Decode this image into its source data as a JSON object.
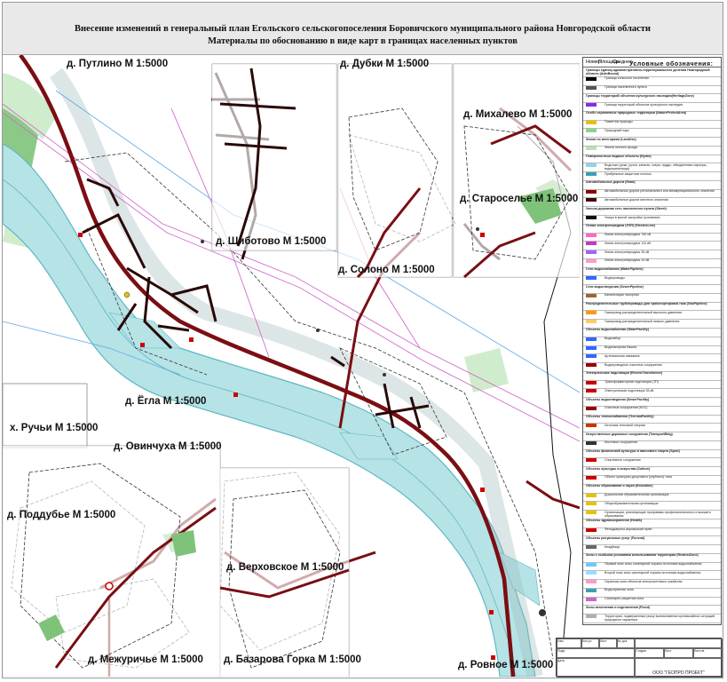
{
  "header": {
    "title_line1": "Внесение изменений в генеральный план Егольского сельскогопоселения Боровичского муниципального района Новгородской области",
    "title_line2": "Материалы по обоснованию в виде карт в границах населенных пунктов"
  },
  "map": {
    "labels": [
      {
        "id": "putilino",
        "text": "д. Путлино М 1:5000"
      },
      {
        "id": "dubki",
        "text": "д. Дубки М 1:5000"
      },
      {
        "id": "mikhalevo",
        "text": "д. Михалево М 1:5000"
      },
      {
        "id": "staroselye",
        "text": "д. Староселье М 1:5000"
      },
      {
        "id": "shibotovo",
        "text": "д. Шиботово М 1:5000"
      },
      {
        "id": "solono",
        "text": "д. Солоно М 1:5000"
      },
      {
        "id": "egla",
        "text": "д. Ёгла М 1:5000"
      },
      {
        "id": "ruchyi",
        "text": "х. Ручьи М 1:5000"
      },
      {
        "id": "ovinchukha",
        "text": "д. Овинчуха М 1:5000"
      },
      {
        "id": "poddubye",
        "text": "д. Поддубье М 1:5000"
      },
      {
        "id": "verkhovskoe",
        "text": "д. Верховское М 1:5000"
      },
      {
        "id": "mezhurichye",
        "text": "д. Межуричье М 1:5000"
      },
      {
        "id": "bazarova",
        "text": "д. Базарова Горка М 1:5000"
      },
      {
        "id": "rovnoe",
        "text": "д. Ровное М 1:5000"
      }
    ]
  },
  "legend": {
    "col1": "Номер",
    "col2": "Площадь",
    "col3": "Среднее",
    "title": "Условные обозначения:",
    "rows": [
      {
        "text": "Границы единиц административно-территориального деления Новгородской области (AdmBound)",
        "section": true
      },
      {
        "text": "Граница сельского поселения",
        "color": "#000000"
      },
      {
        "text": "Граница населенного пункта",
        "color": "#555555"
      },
      {
        "text": "Границы территорий объектов культурного наследия(HeritageZone)",
        "section": true
      },
      {
        "text": "Граница территорий объектов культурного наследия",
        "color": "#8a2be2"
      },
      {
        "text": "Особо охраняемые природные территории (NatureProtectArea)",
        "section": true
      },
      {
        "text": "Памятник природы",
        "color": "#e6c200"
      },
      {
        "text": "Природный парк",
        "color": "#8fd18f"
      },
      {
        "text": "Земли по категориям (LandUse)",
        "section": true
      },
      {
        "text": "Земли лесного фонда",
        "color": "#b7e3b0"
      },
      {
        "text": "Поверхностные водные объекты (Hydro)",
        "section": true
      },
      {
        "text": "Водотоки (реки, ручьи, каналы, озера, пруды, обводненные карьеры, водохранилища)",
        "color": "#8fd4e6"
      },
      {
        "text": "Прибрежные защитные полосы",
        "color": "#3aa0b5"
      },
      {
        "text": "Автомобильные дороги (Road)",
        "section": true
      },
      {
        "text": "Автомобильные дороги регионального или межмуниципального значения",
        "color": "#8b0000"
      },
      {
        "text": "Автомобильные дороги местного значения",
        "color": "#3a0a0a"
      },
      {
        "text": "Улично-дорожная сеть населенного пункта (Street)",
        "section": true
      },
      {
        "text": "Улицы в жилой застройке (основные)",
        "color": "#111111"
      },
      {
        "text": "Линии электропередачи (ЛЭП) (ElectricLine)",
        "section": true
      },
      {
        "text": "Линии электропередачи 750 кВ",
        "color": "#ff66cc"
      },
      {
        "text": "Линии электропередачи 110 кВ",
        "color": "#cc33cc"
      },
      {
        "text": "Линии электропередачи 35 кВ",
        "color": "#9966ff"
      },
      {
        "text": "Линии электропередачи 10 кВ",
        "color": "#ff99cc"
      },
      {
        "text": "Сети водоснабжения (WaterPipeline)",
        "section": true
      },
      {
        "text": "Водопроводы",
        "color": "#3366ff"
      },
      {
        "text": "Сети водоотведения (SewerPipeline)",
        "section": true
      },
      {
        "text": "Канализация напорная",
        "color": "#996633"
      },
      {
        "text": "Распределительные трубопроводы для транспортировки газа (GasPipeline)",
        "section": true
      },
      {
        "text": "Газопровод распределительный высокого давления",
        "color": "#ff9900"
      },
      {
        "text": "Газопровод распределительный низкого давления",
        "color": "#ffcc66"
      },
      {
        "text": "Объекты водоснабжения (WaterFacility)",
        "section": true
      },
      {
        "text": "Водозабор",
        "color": "#3366ff"
      },
      {
        "text": "Водонапорная башня",
        "color": "#3366ff"
      },
      {
        "text": "Артезианская скважина",
        "color": "#3366ff"
      },
      {
        "text": "Водопроводные очистные сооружения",
        "color": "#990000"
      },
      {
        "text": "Электрические подстанции (ElectricTransformer)",
        "section": true
      },
      {
        "text": "Трансформаторная подстанция (ТП)",
        "color": "#cc0000"
      },
      {
        "text": "Электрическая подстанция 35 кВ",
        "color": "#cc0000"
      },
      {
        "text": "Объекты водоотведения (SewerFacility)",
        "section": true
      },
      {
        "text": "Очистные сооружения (КОС)",
        "color": "#990000"
      },
      {
        "text": "Объекты теплоснабжения (ThermalFacility)",
        "section": true
      },
      {
        "text": "Источник тепловой энергии",
        "color": "#cc3300"
      },
      {
        "text": "Искусственные дорожные сооружения (TransportBldg)",
        "section": true
      },
      {
        "text": "Мостовое сооружение",
        "color": "#333333"
      },
      {
        "text": "Объекты физической культуры и массового спорта (Sport)",
        "section": true
      },
      {
        "text": "Спортивное сооружение",
        "color": "#cc0000"
      },
      {
        "text": "Объекты культуры и искусства (Culture)",
        "section": true
      },
      {
        "text": "Объект культурно-досугового (клубного) типа",
        "color": "#cc0000"
      },
      {
        "text": "Объекты образования и науки (Education)",
        "section": true
      },
      {
        "text": "Дошкольная образовательная организация",
        "color": "#e6c200"
      },
      {
        "text": "Общеобразовательная организация",
        "color": "#e6c200"
      },
      {
        "text": "Организации, реализующие программы профессионального и высшего образования",
        "color": "#e6c200"
      },
      {
        "text": "Объекты здравоохранения (Health)",
        "section": true
      },
      {
        "text": "Фельдшерско-акушерский пункт",
        "color": "#cc0000"
      },
      {
        "text": "Объекты ритуальных услуг (Funeral)",
        "section": true
      },
      {
        "text": "Кладбище",
        "color": "#666666"
      },
      {
        "text": "Зоны с особыми условиями использования территории (RestrictZone)",
        "section": true
      },
      {
        "text": "Первый пояс зоны санитарной охраны источника водоснабжения",
        "color": "#66ccff"
      },
      {
        "text": "Второй пояс зоны санитарной охраны источника водоснабжения",
        "color": "#99ddff"
      },
      {
        "text": "Охранная зона объектов электросетевого хозяйства",
        "color": "#ff99cc"
      },
      {
        "text": "Водоохранная зона",
        "color": "#3aa0b5"
      },
      {
        "text": "Санитарно-защитная зона",
        "color": "#cc66cc"
      },
      {
        "text": "Зоны затопления и подтопления (Flood)",
        "section": true
      },
      {
        "text": "Территории, подверженные риску возникновения чрезвычайных ситуаций природного характера",
        "color": "#b0b0b0"
      }
    ]
  },
  "stamp": {
    "org": "ООО \"ГЕОПРО ПРОЕКТ\"",
    "cells": [
      "Изм.",
      "Кол.уч",
      "Лист",
      "№ док",
      "Подп.",
      "Дата",
      "Стадия",
      "Лист",
      "Листов"
    ]
  },
  "colors": {
    "river_fill": "#b6e3e6",
    "river_edge": "#5fb7c2",
    "forest": "#7fc37a",
    "forest_light": "#cfeccc",
    "road_main": "#7a0e12",
    "street": "#2a0808",
    "powerline": "#d36bcf",
    "water_pipe": "#5aa7e8",
    "boundary": "#333333"
  }
}
